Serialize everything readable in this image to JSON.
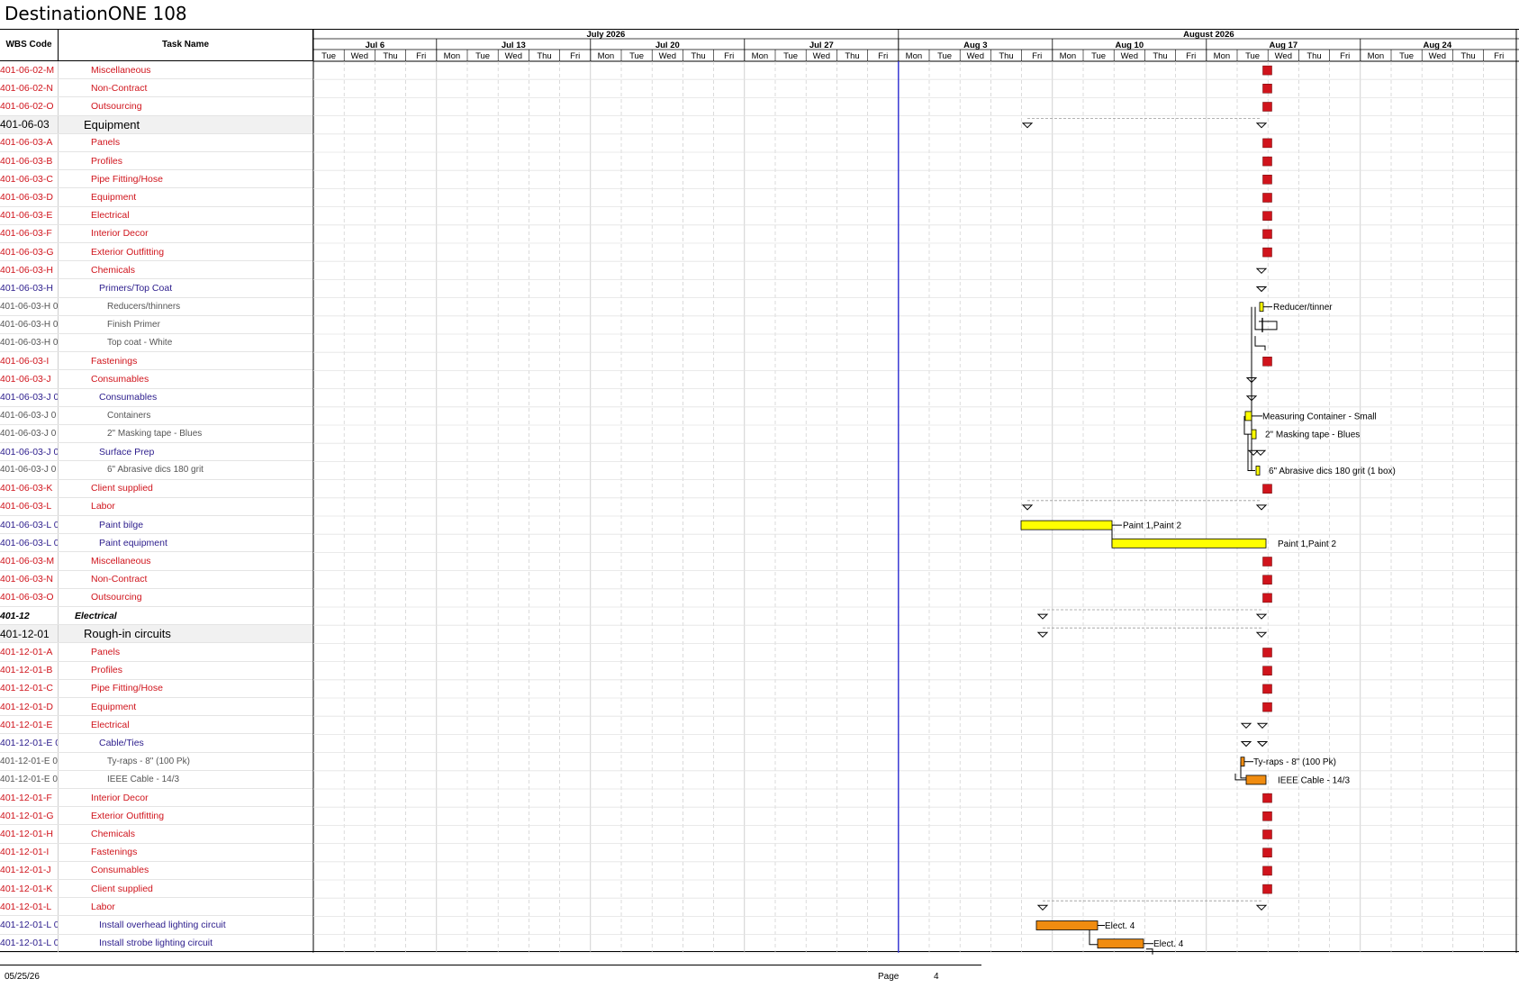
{
  "title": "DestinationONE 108",
  "headers": {
    "wbs": "WBS Code",
    "task": "Task Name"
  },
  "months": [
    "July 2026",
    "August 2026"
  ],
  "weeks": [
    "Jul 6",
    "Jul 13",
    "Jul 20",
    "Jul 27",
    "Aug 3",
    "Aug 10",
    "Aug 17",
    "Aug 24"
  ],
  "days": [
    "Tue",
    "Wed",
    "Thu",
    "Fri",
    "Mon",
    "Tue",
    "Wed",
    "Thu",
    "Fri",
    "Mon",
    "Tue",
    "Wed",
    "Thu",
    "Fri",
    "Mon",
    "Tue",
    "Wed",
    "Thu",
    "Fri",
    "Mon",
    "Tue",
    "Wed",
    "Thu",
    "Fri",
    "Mon",
    "Tue",
    "Wed",
    "Thu",
    "Fri",
    "Mon",
    "Tue",
    "Wed",
    "Thu",
    "Fri",
    "Mon",
    "Tue",
    "Wed",
    "Thu",
    "Fri"
  ],
  "rows": [
    {
      "wbs": "401-06-02-M",
      "name": "Miscellaneous",
      "level": "red"
    },
    {
      "wbs": "401-06-02-N",
      "name": "Non-Contract",
      "level": "red"
    },
    {
      "wbs": "401-06-02-O",
      "name": "Outsourcing",
      "level": "red"
    },
    {
      "wbs": "401-06-03",
      "name": "Equipment",
      "level": "big"
    },
    {
      "wbs": "401-06-03-A",
      "name": "Panels",
      "level": "red"
    },
    {
      "wbs": "401-06-03-B",
      "name": "Profiles",
      "level": "red"
    },
    {
      "wbs": "401-06-03-C",
      "name": "Pipe Fitting/Hose",
      "level": "red"
    },
    {
      "wbs": "401-06-03-D",
      "name": "Equipment",
      "level": "red"
    },
    {
      "wbs": "401-06-03-E",
      "name": "Electrical",
      "level": "red"
    },
    {
      "wbs": "401-06-03-F",
      "name": "Interior Decor",
      "level": "red"
    },
    {
      "wbs": "401-06-03-G",
      "name": "Exterior Outfitting",
      "level": "red"
    },
    {
      "wbs": "401-06-03-H",
      "name": "Chemicals",
      "level": "red"
    },
    {
      "wbs": "401-06-03-H",
      "name": "Primers/Top Coat",
      "level": "blue"
    },
    {
      "wbs": "401-06-03-H 0",
      "name": "Reducers/thinners",
      "level": "gray"
    },
    {
      "wbs": "401-06-03-H 0",
      "name": "Finish Primer",
      "level": "gray"
    },
    {
      "wbs": "401-06-03-H 0",
      "name": "Top coat - White",
      "level": "gray"
    },
    {
      "wbs": "401-06-03-I",
      "name": "Fastenings",
      "level": "red"
    },
    {
      "wbs": "401-06-03-J",
      "name": "Consumables",
      "level": "red"
    },
    {
      "wbs": "401-06-03-J 0",
      "name": "Consumables",
      "level": "blue"
    },
    {
      "wbs": "401-06-03-J 0",
      "name": "Containers",
      "level": "gray"
    },
    {
      "wbs": "401-06-03-J 0",
      "name": "2\" Masking tape - Blues",
      "level": "gray"
    },
    {
      "wbs": "401-06-03-J 0",
      "name": "Surface Prep",
      "level": "blue"
    },
    {
      "wbs": "401-06-03-J 0",
      "name": "6\" Abrasive dics 180 grit",
      "level": "gray"
    },
    {
      "wbs": "401-06-03-K",
      "name": "Client supplied",
      "level": "red"
    },
    {
      "wbs": "401-06-03-L",
      "name": "Labor",
      "level": "red"
    },
    {
      "wbs": "401-06-03-L 0",
      "name": "Paint bilge",
      "level": "blue"
    },
    {
      "wbs": "401-06-03-L 0",
      "name": "Paint equipment",
      "level": "blue"
    },
    {
      "wbs": "401-06-03-M",
      "name": "Miscellaneous",
      "level": "red"
    },
    {
      "wbs": "401-06-03-N",
      "name": "Non-Contract",
      "level": "red"
    },
    {
      "wbs": "401-06-03-O",
      "name": "Outsourcing",
      "level": "red"
    },
    {
      "wbs": "401-12",
      "name": "Electrical",
      "level": "bold"
    },
    {
      "wbs": "401-12-01",
      "name": "Rough-in circuits",
      "level": "big"
    },
    {
      "wbs": "401-12-01-A",
      "name": "Panels",
      "level": "red"
    },
    {
      "wbs": "401-12-01-B",
      "name": "Profiles",
      "level": "red"
    },
    {
      "wbs": "401-12-01-C",
      "name": "Pipe Fitting/Hose",
      "level": "red"
    },
    {
      "wbs": "401-12-01-D",
      "name": "Equipment",
      "level": "red"
    },
    {
      "wbs": "401-12-01-E",
      "name": "Electrical",
      "level": "red"
    },
    {
      "wbs": "401-12-01-E 0",
      "name": "Cable/Ties",
      "level": "blue"
    },
    {
      "wbs": "401-12-01-E 0",
      "name": "Ty-raps - 8\" (100 Pk)",
      "level": "gray"
    },
    {
      "wbs": "401-12-01-E 0",
      "name": "IEEE Cable - 14/3",
      "level": "gray"
    },
    {
      "wbs": "401-12-01-F",
      "name": "Interior Decor",
      "level": "red"
    },
    {
      "wbs": "401-12-01-G",
      "name": "Exterior Outfitting",
      "level": "red"
    },
    {
      "wbs": "401-12-01-H",
      "name": "Chemicals",
      "level": "red"
    },
    {
      "wbs": "401-12-01-I",
      "name": "Fastenings",
      "level": "red"
    },
    {
      "wbs": "401-12-01-J",
      "name": "Consumables",
      "level": "red"
    },
    {
      "wbs": "401-12-01-K",
      "name": "Client supplied",
      "level": "red"
    },
    {
      "wbs": "401-12-01-L",
      "name": "Labor",
      "level": "red"
    },
    {
      "wbs": "401-12-01-L 0",
      "name": "Install overhead lighting circuit",
      "level": "blue"
    },
    {
      "wbs": "401-12-01-L 0",
      "name": "Install strobe lighting circuit",
      "level": "blue"
    }
  ],
  "bar_labels": {
    "reducer": "Reducer/tinner",
    "container": "Measuring Container - Small",
    "masking": "2\" Masking tape - Blues",
    "abrasive": "6\" Abrasive dics 180 grit (1 box)",
    "paint_bilge": "Paint 1,Paint 2",
    "paint_equipment": "Paint 1,Paint 2",
    "tyraps": "Ty-raps - 8\" (100 Pk)",
    "ieee": "IEEE Cable - 14/3",
    "elect1": "Elect. 4",
    "elect2": "Elect. 4"
  },
  "colors": {
    "milestone": "#d0141c",
    "paint_bar": "#ffff00",
    "elec_bar": "#f08c10",
    "today_line": "#2b2bd0"
  },
  "footer": {
    "date": "05/25/26",
    "page_label": "Page",
    "page_number": "4"
  }
}
